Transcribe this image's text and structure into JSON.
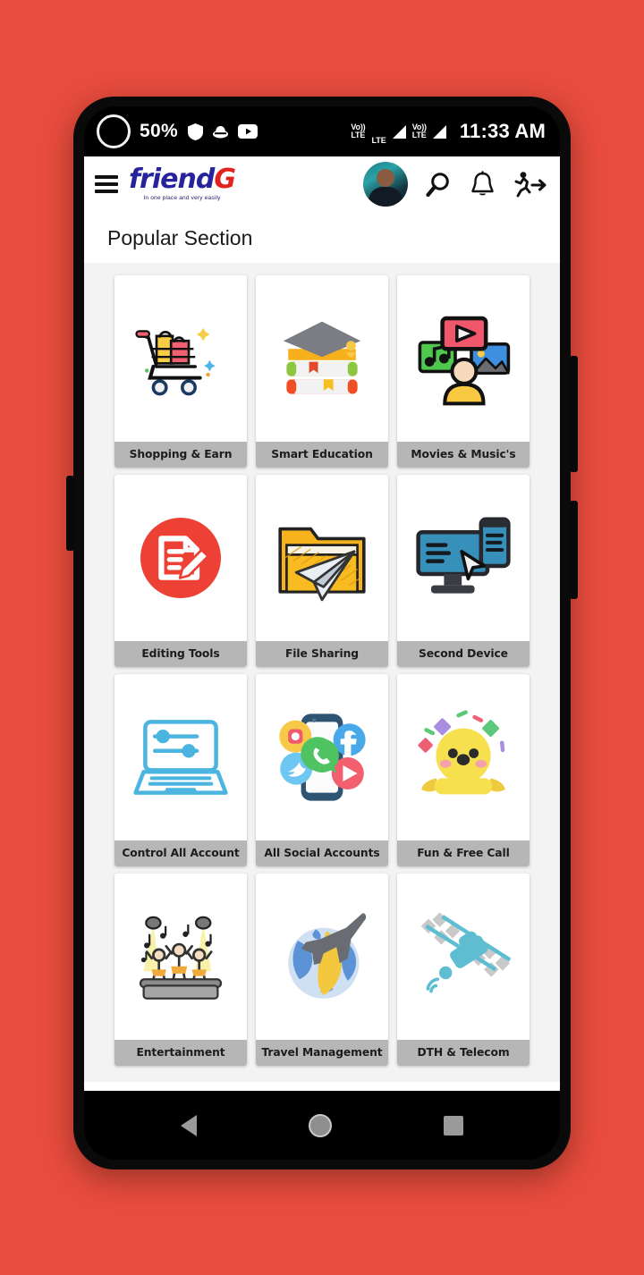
{
  "background_color": "#e84c3d",
  "status_bar": {
    "battery_percent": "50%",
    "icons": [
      "shield-icon",
      "hat-icon",
      "youtube-icon"
    ],
    "network": [
      {
        "volte": "Vo)) LTE",
        "label": "LTE"
      },
      {
        "volte": "Vo)) LTE",
        "label": ""
      }
    ],
    "volte_top": "Vo))",
    "volte_bottom": "LTE",
    "lte_label": "LTE",
    "time": "11:33 AM"
  },
  "header": {
    "menu_icon": "hamburger-menu-icon",
    "logo": {
      "text_primary": "friend",
      "text_accent": "G",
      "tagline": "In one place and very easily",
      "color_primary": "#27239b",
      "color_accent": "#e0231f"
    },
    "actions": [
      {
        "name": "avatar",
        "label": ""
      },
      {
        "name": "search-icon",
        "label": ""
      },
      {
        "name": "notification-bell-icon",
        "label": ""
      },
      {
        "name": "logout-exit-icon",
        "label": ""
      }
    ]
  },
  "main": {
    "section_title": "Popular Section",
    "label_bar_color": "#b6b6b6",
    "cards": [
      {
        "label": "Shopping & Earn",
        "icon": "shopping-cart-icon"
      },
      {
        "label": "Smart Education",
        "icon": "graduation-books-icon"
      },
      {
        "label": "Movies & Music's",
        "icon": "media-person-icon"
      },
      {
        "label": "Editing Tools",
        "icon": "document-edit-icon"
      },
      {
        "label": "File Sharing",
        "icon": "folder-paper-plane-icon"
      },
      {
        "label": "Second Device",
        "icon": "monitor-phone-icon"
      },
      {
        "label": "Control All Account",
        "icon": "laptop-settings-icon"
      },
      {
        "label": "All Social Accounts",
        "icon": "social-phone-icon"
      },
      {
        "label": "Fun & Free Call",
        "icon": "smiley-confetti-icon"
      },
      {
        "label": "Entertainment",
        "icon": "stage-performers-icon"
      },
      {
        "label": "Travel Management",
        "icon": "airplane-globe-icon"
      },
      {
        "label": "DTH & Telecom",
        "icon": "satellite-icon"
      }
    ]
  },
  "nav_bar": {
    "back": "back-button",
    "home": "home-button",
    "recents": "recents-button"
  }
}
